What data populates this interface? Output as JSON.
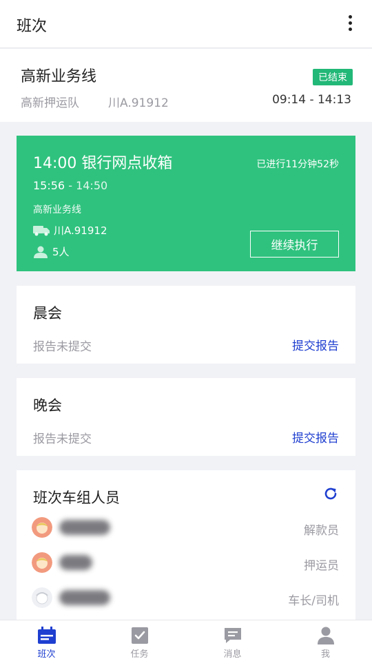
{
  "appbar": {
    "title": "班次",
    "more_icon": "more-vertical-icon"
  },
  "shift": {
    "route": "高新业务线",
    "status": "已结束",
    "team": "高新押运队",
    "plate": "川A.91912",
    "time_range": "09:14 - 14:13"
  },
  "task": {
    "name": "14:00 银行网点收箱",
    "elapsed": "已进行11分钟52秒",
    "start": "15:56",
    "sep": " - ",
    "end": "14:50",
    "line": "高新业务线",
    "vehicle": "川A.91912",
    "people": "5人",
    "action": "继续执行",
    "color": "#2fc27e"
  },
  "meetings": [
    {
      "title": "晨会",
      "status": "报告未提交",
      "action": "提交报告"
    },
    {
      "title": "晚会",
      "status": "报告未提交",
      "action": "提交报告"
    }
  ],
  "crew": {
    "title": "班次车组人员",
    "refresh_icon": "refresh-icon",
    "members": [
      {
        "name": "",
        "role": "解款员",
        "avatar": "female-avatar-icon"
      },
      {
        "name": "",
        "role": "押运员",
        "avatar": "female-avatar-icon"
      },
      {
        "name": "",
        "role": "车长/司机",
        "avatar": "male-avatar-icon"
      }
    ]
  },
  "tabs": [
    {
      "label": "班次",
      "icon": "calendar-icon",
      "active": true
    },
    {
      "label": "任务",
      "icon": "checkbox-icon",
      "active": false
    },
    {
      "label": "消息",
      "icon": "message-icon",
      "active": false
    },
    {
      "label": "我",
      "icon": "person-icon",
      "active": false
    }
  ],
  "colors": {
    "accent": "#1f3fd0",
    "green": "#2fc27e",
    "badge": "#22b877"
  }
}
